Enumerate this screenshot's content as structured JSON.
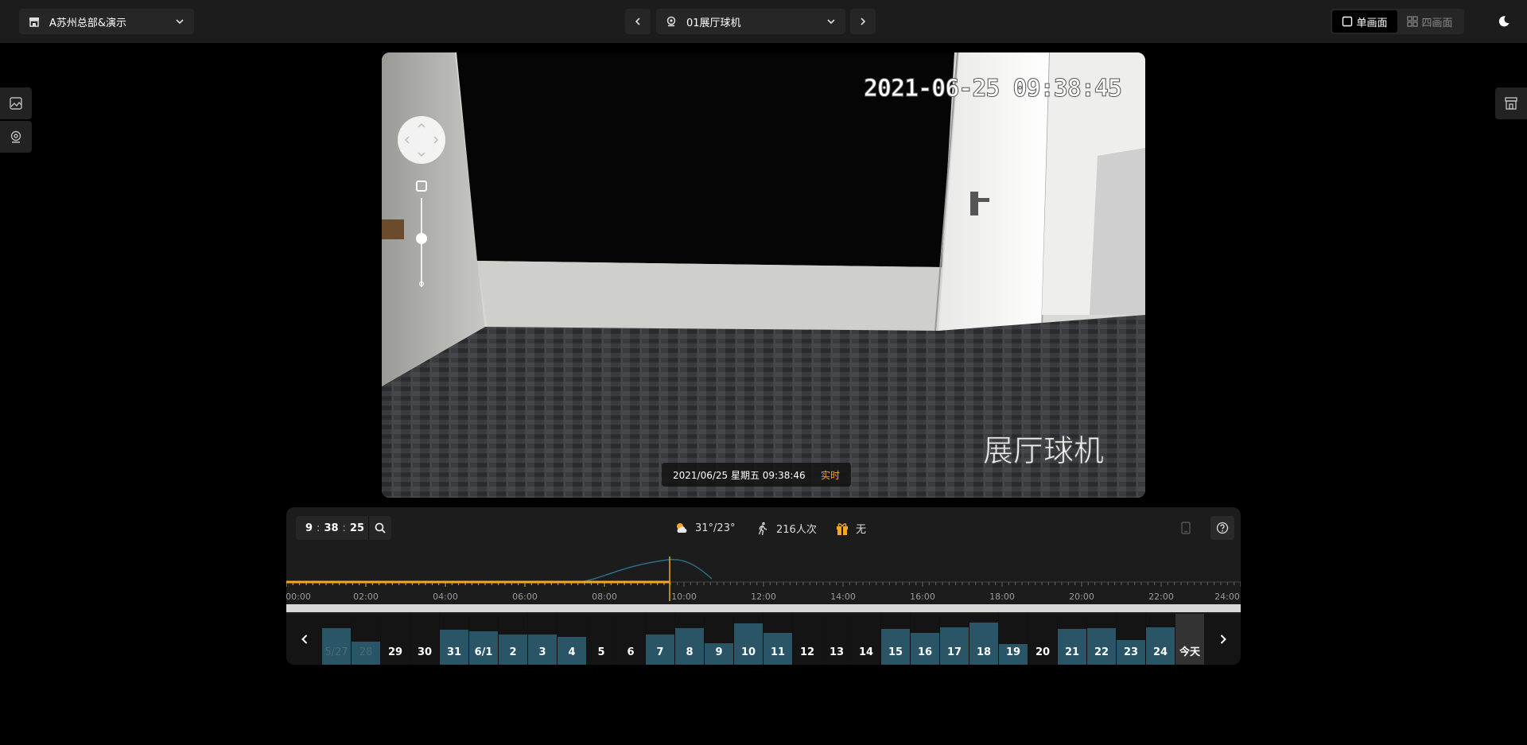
{
  "header": {
    "store_name": "A苏州总部&演示",
    "camera_name": "01展厅球机",
    "view_single": "单画面",
    "view_quad": "四画面"
  },
  "video": {
    "osd_timestamp": "2021-06-25  09:38:45",
    "osd_camera_label": "展厅球机",
    "info_datetime": "2021/06/25 星期五 09:38:46",
    "live_label": "实时"
  },
  "controls": {
    "time_h": "9",
    "time_m": "38",
    "time_s": "25",
    "weather": "31°/23°",
    "visitors": "216人次",
    "gift": "无"
  },
  "timeline": {
    "hour_labels": [
      "00:00",
      "02:00",
      "04:00",
      "06:00",
      "08:00",
      "10:00",
      "12:00",
      "14:00",
      "16:00",
      "18:00",
      "20:00",
      "22:00",
      "24:00"
    ],
    "current_position_hours": 9.64,
    "playhead_color": "#f5a623"
  },
  "days": [
    {
      "label": "5/27",
      "level": 0.72,
      "dim": true
    },
    {
      "label": "28",
      "level": 0.45,
      "dim": true
    },
    {
      "label": "29",
      "level": 0,
      "dim": false
    },
    {
      "label": "30",
      "level": 0,
      "dim": false
    },
    {
      "label": "31",
      "level": 0.68,
      "dim": false
    },
    {
      "label": "6/1",
      "level": 0.66,
      "dim": false
    },
    {
      "label": "2",
      "level": 0.6,
      "dim": false
    },
    {
      "label": "3",
      "level": 0.6,
      "dim": false
    },
    {
      "label": "4",
      "level": 0.55,
      "dim": false
    },
    {
      "label": "5",
      "level": 0,
      "dim": false
    },
    {
      "label": "6",
      "level": 0,
      "dim": false
    },
    {
      "label": "7",
      "level": 0.6,
      "dim": false
    },
    {
      "label": "8",
      "level": 0.72,
      "dim": false
    },
    {
      "label": "9",
      "level": 0.42,
      "dim": false
    },
    {
      "label": "10",
      "level": 0.82,
      "dim": false
    },
    {
      "label": "11",
      "level": 0.63,
      "dim": false
    },
    {
      "label": "12",
      "level": 0,
      "dim": false
    },
    {
      "label": "13",
      "level": 0,
      "dim": false
    },
    {
      "label": "14",
      "level": 0,
      "dim": false
    },
    {
      "label": "15",
      "level": 0.7,
      "dim": false
    },
    {
      "label": "16",
      "level": 0.63,
      "dim": false
    },
    {
      "label": "17",
      "level": 0.73,
      "dim": false
    },
    {
      "label": "18",
      "level": 0.83,
      "dim": false
    },
    {
      "label": "19",
      "level": 0.4,
      "dim": false
    },
    {
      "label": "20",
      "level": 0,
      "dim": false
    },
    {
      "label": "21",
      "level": 0.7,
      "dim": false
    },
    {
      "label": "22",
      "level": 0.72,
      "dim": false
    },
    {
      "label": "23",
      "level": 0.48,
      "dim": false
    },
    {
      "label": "24",
      "level": 0.73,
      "dim": false
    },
    {
      "label": "今天",
      "level": 0,
      "dim": false,
      "today": true
    }
  ]
}
